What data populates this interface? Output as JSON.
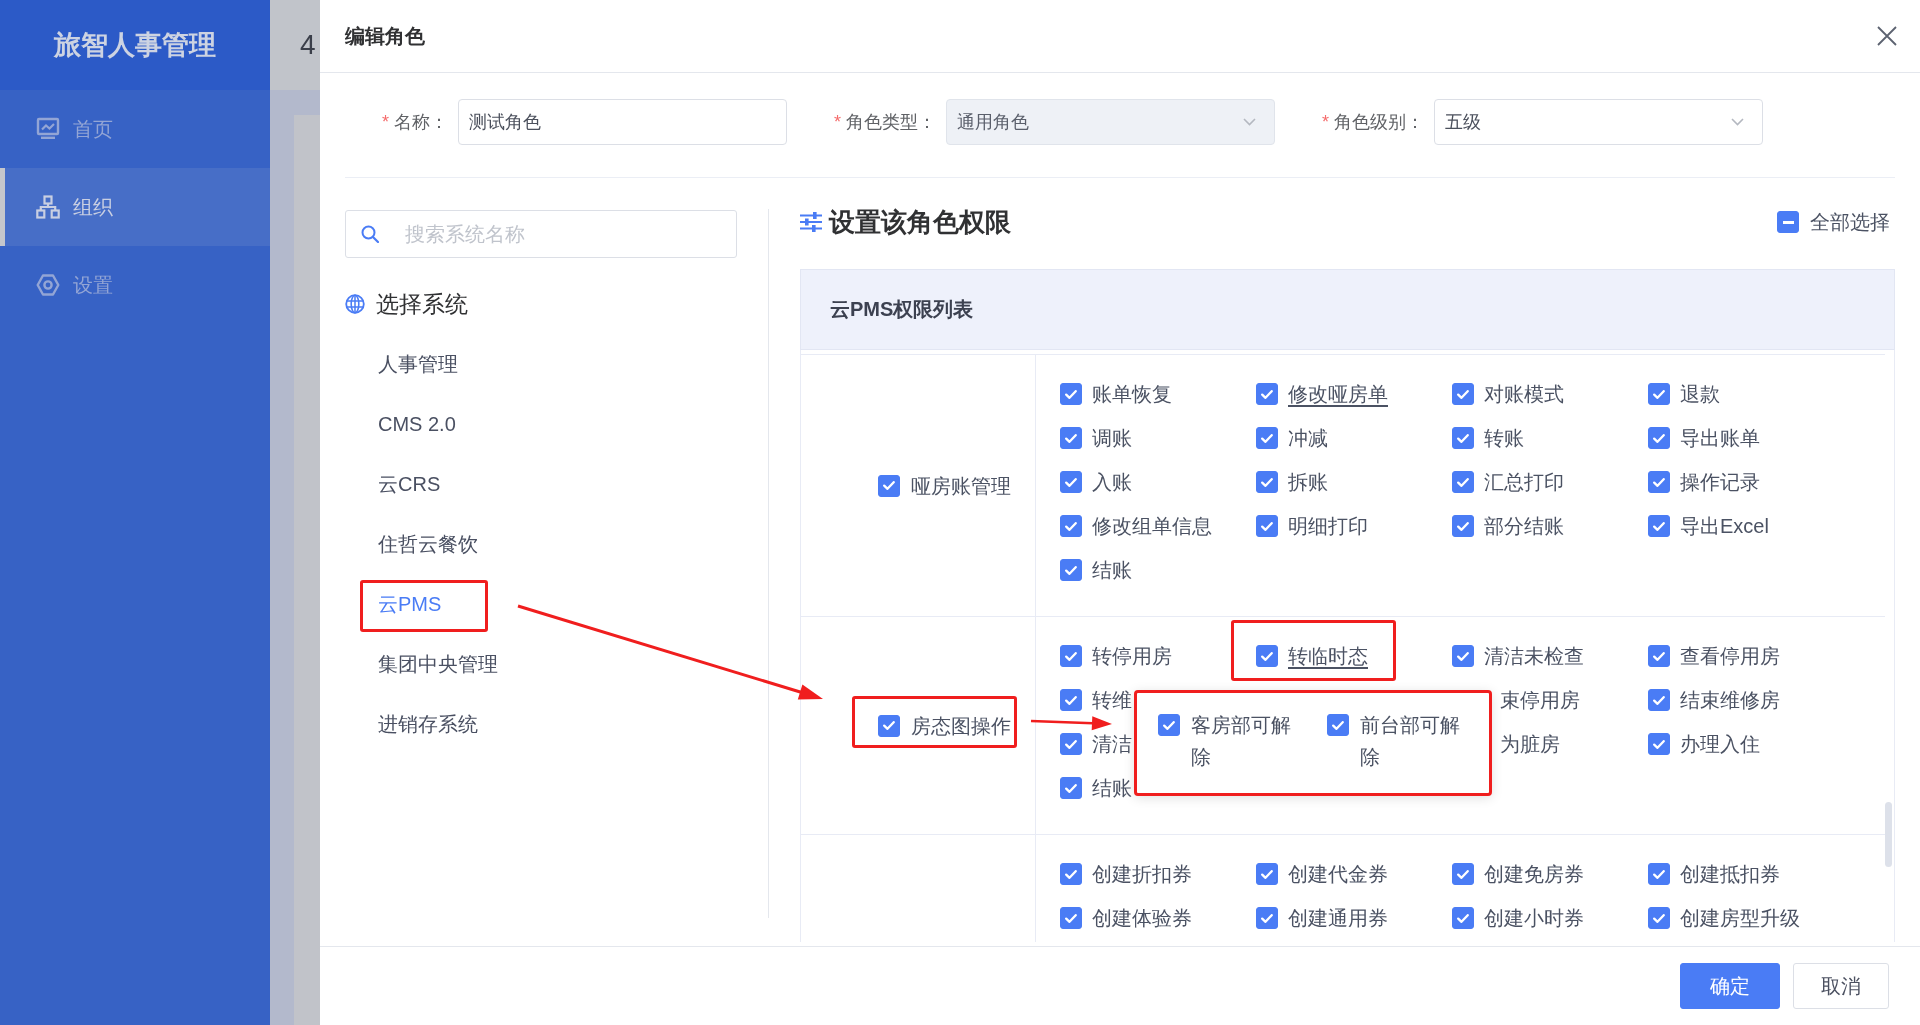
{
  "sidebar": {
    "title": "旅智人事管理",
    "items": [
      {
        "label": "首页",
        "selected": false
      },
      {
        "label": "组织",
        "selected": true
      },
      {
        "label": "设置",
        "selected": false
      }
    ]
  },
  "background_page": {
    "header_text": "4"
  },
  "dialog": {
    "title": "编辑角色",
    "fields": [
      {
        "kind": "input",
        "required_mark": "*",
        "label": "名称：",
        "value": "测试角色",
        "disabled": false
      },
      {
        "kind": "select",
        "required_mark": "*",
        "label": "角色类型：",
        "value": "通用角色",
        "disabled": true
      },
      {
        "kind": "select",
        "required_mark": "*",
        "label": "角色级别：",
        "value": "五级",
        "disabled": false
      }
    ],
    "system_panel": {
      "search": {
        "placeholder": "搜索系统名称"
      },
      "heading": "选择系统",
      "systems": [
        {
          "label": "人事管理",
          "selected": false,
          "highlighted": false
        },
        {
          "label": "CMS 2.0",
          "selected": false,
          "highlighted": false
        },
        {
          "label": "云CRS",
          "selected": false,
          "highlighted": false
        },
        {
          "label": "住哲云餐饮",
          "selected": false,
          "highlighted": false
        },
        {
          "label": "云PMS",
          "selected": true,
          "highlighted": true
        },
        {
          "label": "集团中央管理",
          "selected": false,
          "highlighted": false
        },
        {
          "label": "进销存系统",
          "selected": false,
          "highlighted": false
        }
      ]
    },
    "permissions": {
      "heading": "设置该角色权限",
      "select_all": {
        "label": "全部选择",
        "indeterminate": true
      },
      "table_title": "云PMS权限列表",
      "groups": [
        {
          "label": "哑房账管理",
          "checked": true,
          "highlighted": false,
          "items": [
            {
              "kind": "option",
              "label": "账单恢复",
              "checked": true,
              "highlighted": false
            },
            {
              "kind": "link",
              "label": "修改哑房单",
              "checked": true,
              "highlighted": false
            },
            {
              "kind": "option",
              "label": "对账模式",
              "checked": true,
              "highlighted": false
            },
            {
              "kind": "option",
              "label": "退款",
              "checked": true,
              "highlighted": false
            },
            {
              "kind": "option",
              "label": "调账",
              "checked": true,
              "highlighted": false
            },
            {
              "kind": "option",
              "label": "冲减",
              "checked": true,
              "highlighted": false
            },
            {
              "kind": "option",
              "label": "转账",
              "checked": true,
              "highlighted": false
            },
            {
              "kind": "option",
              "label": "导出账单",
              "checked": true,
              "highlighted": false
            },
            {
              "kind": "option",
              "label": "入账",
              "checked": true,
              "highlighted": false
            },
            {
              "kind": "option",
              "label": "拆账",
              "checked": true,
              "highlighted": false
            },
            {
              "kind": "option",
              "label": "汇总打印",
              "checked": true,
              "highlighted": false
            },
            {
              "kind": "option",
              "label": "操作记录",
              "checked": true,
              "highlighted": false
            },
            {
              "kind": "option",
              "label": "修改组单信息",
              "checked": true,
              "highlighted": false
            },
            {
              "kind": "option",
              "label": "明细打印",
              "checked": true,
              "highlighted": false
            },
            {
              "kind": "option",
              "label": "部分结账",
              "checked": true,
              "highlighted": false
            },
            {
              "kind": "option",
              "label": "导出Excel",
              "checked": true,
              "highlighted": false
            },
            {
              "kind": "option",
              "label": "结账",
              "checked": true,
              "highlighted": false
            }
          ]
        },
        {
          "label": "房态图操作",
          "checked": true,
          "highlighted": true,
          "items": [
            {
              "kind": "option",
              "label": "转停用房",
              "checked": true,
              "highlighted": false
            },
            {
              "kind": "link",
              "label": "转临时态",
              "checked": true,
              "highlighted": true,
              "popup": {
                "highlighted": true,
                "options": [
                  {
                    "label": "客房部可解除",
                    "checked": true
                  },
                  {
                    "label": "前台部可解除",
                    "checked": true
                  }
                ]
              }
            },
            {
              "kind": "option",
              "label": "清洁未检查",
              "checked": true,
              "highlighted": false
            },
            {
              "kind": "option",
              "label": "查看停用房",
              "checked": true,
              "highlighted": false
            },
            {
              "kind": "option",
              "label": "转维",
              "checked": true,
              "highlighted": false
            },
            {
              "kind": "fragment",
              "label": "束停用房"
            },
            {
              "kind": "option",
              "label": "结束维修房",
              "checked": true,
              "highlighted": false
            },
            {
              "kind": "option",
              "label": "清洁",
              "checked": true,
              "highlighted": false
            },
            {
              "kind": "fragment",
              "label": "为脏房"
            },
            {
              "kind": "option",
              "label": "办理入住",
              "checked": true,
              "highlighted": false
            },
            {
              "kind": "option",
              "label": "结账",
              "checked": true,
              "highlighted": false
            }
          ]
        },
        {
          "items": [
            {
              "kind": "option",
              "label": "创建折扣券",
              "checked": true,
              "highlighted": false
            },
            {
              "kind": "option",
              "label": "创建代金券",
              "checked": true,
              "highlighted": false
            },
            {
              "kind": "option",
              "label": "创建免房券",
              "checked": true,
              "highlighted": false
            },
            {
              "kind": "option",
              "label": "创建抵扣券",
              "checked": true,
              "highlighted": false
            },
            {
              "kind": "option",
              "label": "创建体验券",
              "checked": true,
              "highlighted": false
            },
            {
              "kind": "option",
              "label": "创建通用券",
              "checked": true,
              "highlighted": false
            },
            {
              "kind": "option",
              "label": "创建小时券",
              "checked": true,
              "highlighted": false
            },
            {
              "kind": "option",
              "label": "创建房型升级",
              "checked": true,
              "highlighted": false
            }
          ]
        }
      ]
    },
    "buttons": [
      {
        "kind": "primary",
        "label": "确定"
      },
      {
        "kind": "default",
        "label": "取消"
      }
    ]
  }
}
